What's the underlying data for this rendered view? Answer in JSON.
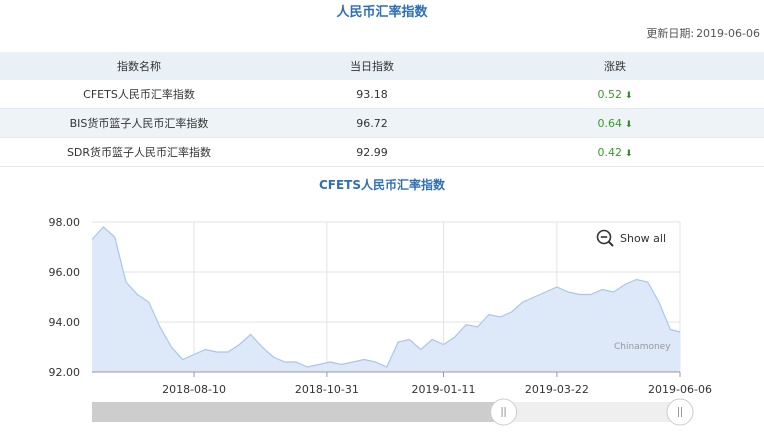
{
  "page": {
    "title": "人民币汇率指数"
  },
  "update": {
    "label": "更新日期:",
    "date": "2019-06-06"
  },
  "table": {
    "headers": [
      "指数名称",
      "当日指数",
      "涨跌"
    ],
    "rows": [
      {
        "name": "CFETS人民币汇率指数",
        "value": "93.18",
        "change": "0.52",
        "direction": "down"
      },
      {
        "name": "BIS货币篮子人民币汇率指数",
        "value": "96.72",
        "change": "0.64",
        "direction": "down"
      },
      {
        "name": "SDR货币篮子人民币汇率指数",
        "value": "92.99",
        "change": "0.42",
        "direction": "down"
      }
    ]
  },
  "colors": {
    "accent": "#2f6fb6",
    "change": "#3a9a2a",
    "line": "#a9c6ec",
    "area": "#dde8f8"
  },
  "controls": {
    "show_all": "Show all",
    "zoom_icon": "zoom-out-icon"
  },
  "watermark": "Chinamoney",
  "chart_data": {
    "type": "area",
    "title": "CFETS人民币汇率指数",
    "xlabel": "",
    "ylabel": "",
    "ylim": [
      92,
      98
    ],
    "yticks": [
      "92.00",
      "94.00",
      "96.00",
      "98.00"
    ],
    "xticks": [
      "2018-08-10",
      "2018-10-31",
      "2019-01-11",
      "2019-03-22",
      "2019-06-06"
    ],
    "xlim": [
      "2018-06-08",
      "2019-06-06"
    ],
    "grid": true,
    "x": [
      "2018-06-08",
      "2018-06-15",
      "2018-06-22",
      "2018-06-29",
      "2018-07-06",
      "2018-07-13",
      "2018-07-20",
      "2018-07-27",
      "2018-08-03",
      "2018-08-10",
      "2018-08-17",
      "2018-08-24",
      "2018-08-31",
      "2018-09-07",
      "2018-09-14",
      "2018-09-21",
      "2018-09-28",
      "2018-10-05",
      "2018-10-12",
      "2018-10-19",
      "2018-10-26",
      "2018-11-02",
      "2018-11-09",
      "2018-11-16",
      "2018-11-23",
      "2018-11-30",
      "2018-12-07",
      "2018-12-14",
      "2018-12-21",
      "2018-12-28",
      "2019-01-04",
      "2019-01-11",
      "2019-01-18",
      "2019-01-25",
      "2019-02-01",
      "2019-02-08",
      "2019-02-15",
      "2019-02-22",
      "2019-03-01",
      "2019-03-08",
      "2019-03-15",
      "2019-03-22",
      "2019-03-29",
      "2019-04-05",
      "2019-04-12",
      "2019-04-19",
      "2019-04-26",
      "2019-05-03",
      "2019-05-10",
      "2019-05-17",
      "2019-05-24",
      "2019-05-31",
      "2019-06-06"
    ],
    "series": [
      {
        "values": [
          97.3,
          97.8,
          97.4,
          95.6,
          95.1,
          94.8,
          93.8,
          93.0,
          92.5,
          92.7,
          92.9,
          92.8,
          92.8,
          93.1,
          93.5,
          93.0,
          92.6,
          92.4,
          92.4,
          92.2,
          92.3,
          92.4,
          92.3,
          92.4,
          92.5,
          92.4,
          92.2,
          93.2,
          93.3,
          92.9,
          93.3,
          93.1,
          93.4,
          93.9,
          93.8,
          94.3,
          94.2,
          94.4,
          94.8,
          95.0,
          95.2,
          95.4,
          95.2,
          95.1,
          95.1,
          95.3,
          95.2,
          95.5,
          95.7,
          95.6,
          94.8,
          93.7,
          93.6
        ]
      }
    ]
  },
  "slider": {
    "selection_start": 0.0,
    "selection_end": 0.7
  }
}
